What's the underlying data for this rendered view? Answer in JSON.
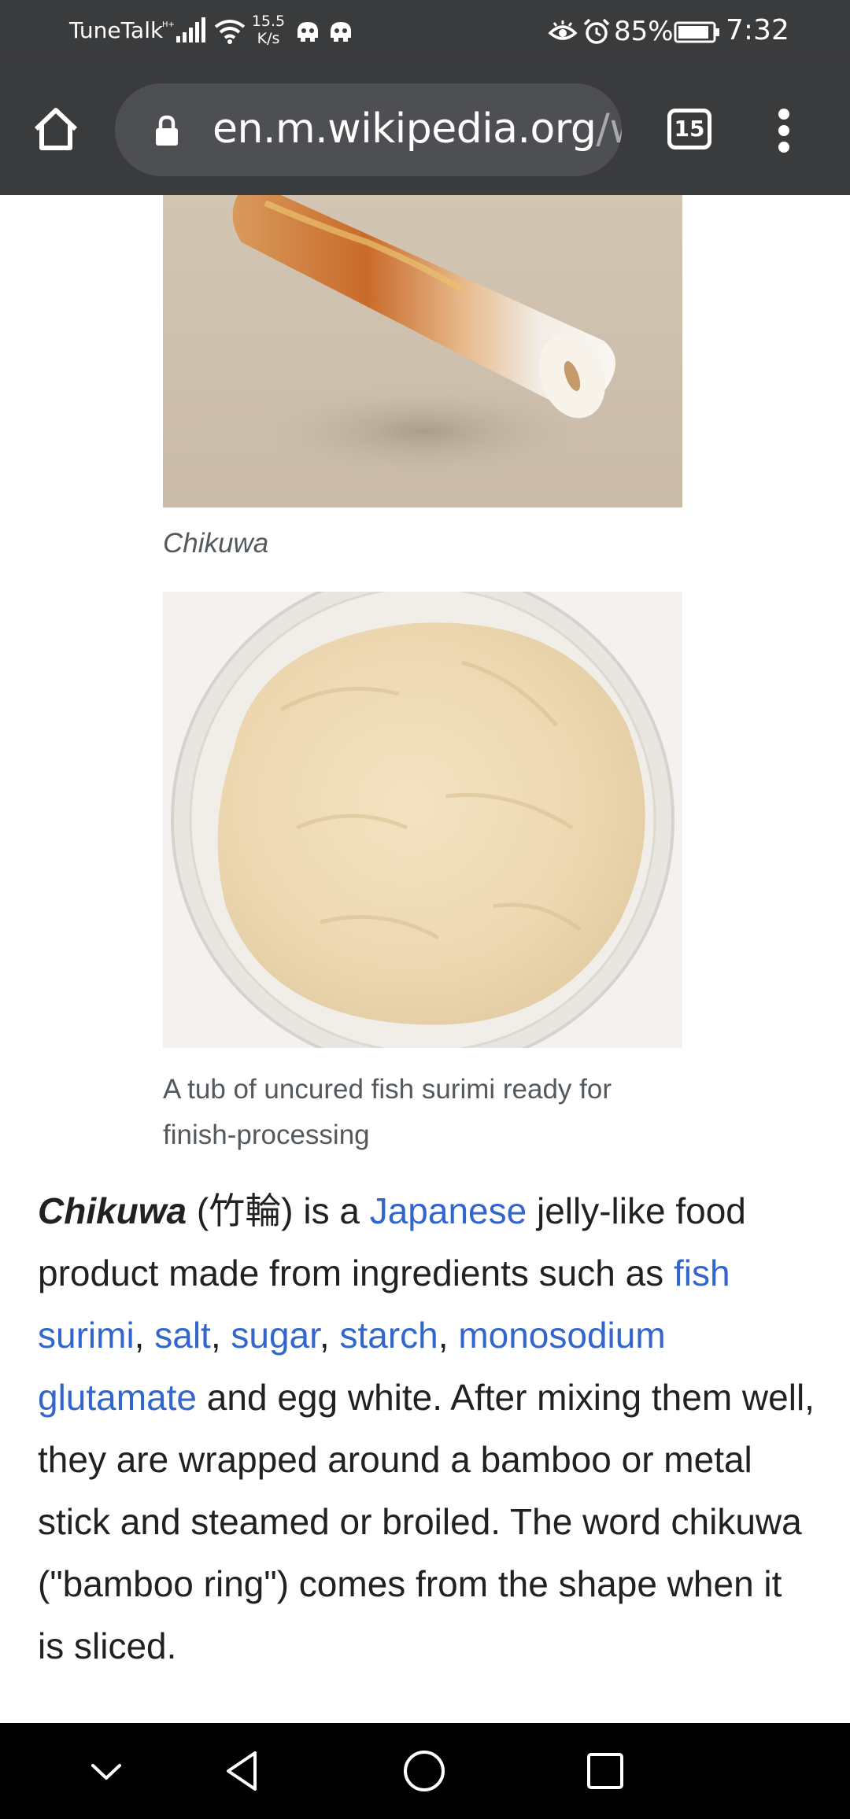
{
  "status_bar": {
    "carrier": "TuneTalk",
    "net_speed_value": "15.5",
    "net_speed_unit": "K/s",
    "battery": "85%",
    "time": "7:32",
    "icons": [
      "signal-icon",
      "wifi-icon",
      "app-notification-icon",
      "eye-comfort-icon",
      "alarm-icon",
      "battery-icon"
    ]
  },
  "browser": {
    "url_main": "en.m.wikipedia.org",
    "url_rest": "/wi",
    "tab_count": "15"
  },
  "figures": [
    {
      "caption": "Chikuwa"
    },
    {
      "caption": "A tub of uncured fish surimi ready for finish-processing"
    }
  ],
  "paragraph": {
    "term": "Chikuwa",
    "t1": " (竹輪) is a ",
    "link_japanese": "Japanese",
    "t2": " jelly-like food product made from ingredients such as ",
    "link_fish_surimi": "fish surimi",
    "t3": ", ",
    "link_salt": "salt",
    "t4": ", ",
    "link_sugar": "sugar",
    "t5": ", ",
    "link_starch": "starch",
    "t6": ", ",
    "link_msg": "monosodium glutamate",
    "t7": " and egg white. After mixing them well, they are wrapped around a bamboo or metal stick and steamed or broiled. The word chikuwa (\"bamboo ring\") comes from the shape when it is sliced."
  },
  "colors": {
    "chrome_bar": "#3a3b3d",
    "omnibox": "#4e4f52",
    "link": "#3366cc",
    "caption": "#54595d",
    "body_text": "#202122"
  }
}
